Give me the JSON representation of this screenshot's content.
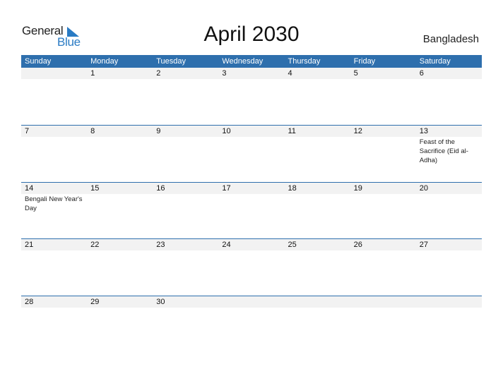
{
  "logo": {
    "line1": "General",
    "line2": "Blue"
  },
  "title": "April 2030",
  "country": "Bangladesh",
  "colors": {
    "accent": "#2e6fad",
    "date_strip": "#f2f2f2",
    "logo_blue": "#2a7bc4"
  },
  "weekdays": [
    "Sunday",
    "Monday",
    "Tuesday",
    "Wednesday",
    "Thursday",
    "Friday",
    "Saturday"
  ],
  "weeks": [
    [
      {
        "d": ""
      },
      {
        "d": "1"
      },
      {
        "d": "2"
      },
      {
        "d": "3"
      },
      {
        "d": "4"
      },
      {
        "d": "5"
      },
      {
        "d": "6"
      }
    ],
    [
      {
        "d": "7"
      },
      {
        "d": "8"
      },
      {
        "d": "9"
      },
      {
        "d": "10"
      },
      {
        "d": "11"
      },
      {
        "d": "12"
      },
      {
        "d": "13",
        "event": "Feast of the Sacrifice (Eid al-Adha)"
      }
    ],
    [
      {
        "d": "14",
        "event": "Bengali New Year's Day"
      },
      {
        "d": "15"
      },
      {
        "d": "16"
      },
      {
        "d": "17"
      },
      {
        "d": "18"
      },
      {
        "d": "19"
      },
      {
        "d": "20"
      }
    ],
    [
      {
        "d": "21"
      },
      {
        "d": "22"
      },
      {
        "d": "23"
      },
      {
        "d": "24"
      },
      {
        "d": "25"
      },
      {
        "d": "26"
      },
      {
        "d": "27"
      }
    ],
    [
      {
        "d": "28"
      },
      {
        "d": "29"
      },
      {
        "d": "30"
      },
      {
        "d": ""
      },
      {
        "d": ""
      },
      {
        "d": ""
      },
      {
        "d": ""
      }
    ]
  ]
}
